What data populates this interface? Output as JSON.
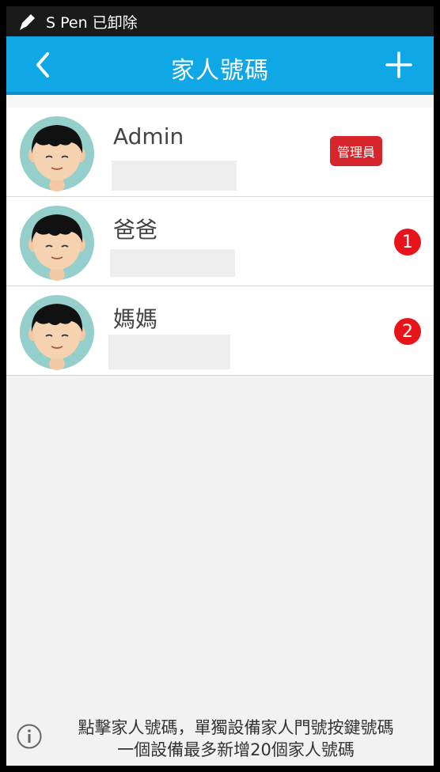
{
  "status_bar": {
    "icon": "pen-icon",
    "text": "S Pen 已卸除"
  },
  "app_bar": {
    "title": "家人號碼",
    "back_icon": "chevron-left-icon",
    "add_icon": "plus-icon",
    "color": "#0fa7e6"
  },
  "members": [
    {
      "name": "Admin",
      "badge": "管理員",
      "badge_type": "role",
      "phone": ""
    },
    {
      "name": "爸爸",
      "badge": "1",
      "badge_type": "number",
      "phone": ""
    },
    {
      "name": "媽媽",
      "badge": "2",
      "badge_type": "number",
      "phone": ""
    }
  ],
  "footer": {
    "icon": "info-icon",
    "line1": "點擊家人號碼，單獨設備家人門號按鍵號碼",
    "line2": "一個設備最多新增20個家人號碼"
  }
}
